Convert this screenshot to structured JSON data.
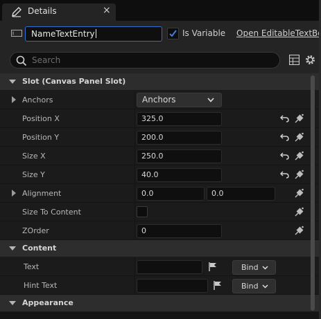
{
  "tab": {
    "title": "Details",
    "close": "×"
  },
  "header": {
    "name_value": "NameTextEntry",
    "is_variable_label": "Is Variable",
    "is_variable_checked": true,
    "open_link": "Open EditableTextBo"
  },
  "search": {
    "placeholder": "Search"
  },
  "sections": {
    "slot": "Slot (Canvas Panel Slot)",
    "content": "Content",
    "appearance": "Appearance"
  },
  "props": {
    "anchors": {
      "label": "Anchors",
      "value": "Anchors"
    },
    "position_x": {
      "label": "Position X",
      "value": "325.0"
    },
    "position_y": {
      "label": "Position Y",
      "value": "200.0"
    },
    "size_x": {
      "label": "Size X",
      "value": "250.0"
    },
    "size_y": {
      "label": "Size Y",
      "value": "40.0"
    },
    "alignment": {
      "label": "Alignment",
      "x": "0.0",
      "y": "0.0"
    },
    "size_to_content": {
      "label": "Size To Content",
      "checked": false
    },
    "zorder": {
      "label": "ZOrder",
      "value": "0"
    },
    "text": {
      "label": "Text",
      "value": "",
      "bind": "Bind"
    },
    "hint_text": {
      "label": "Hint Text",
      "value": "",
      "bind": "Bind"
    }
  },
  "colors": {
    "accent": "#2f6fcf",
    "panel": "#242424",
    "row": "#1b1b1b",
    "section": "#2d2d2d"
  },
  "icons": [
    "pencil-icon",
    "close-icon",
    "widget-icon",
    "checkmark-icon",
    "search-icon",
    "table-icon",
    "gear-icon",
    "chevron-down-icon",
    "reset-arrow-icon",
    "keyframe-pin-icon",
    "flag-icon"
  ]
}
